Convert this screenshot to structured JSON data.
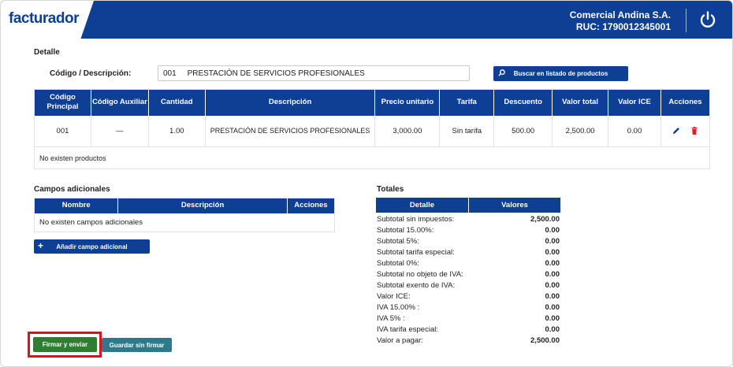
{
  "header": {
    "logo_text": "facturador",
    "company_name": "Comercial Andina S.A.",
    "ruc": "RUC: 1790012345001",
    "colors": {
      "primary": "#0d3f95",
      "accent": "#f0a500"
    },
    "power_icon": "power-icon"
  },
  "detalle": {
    "title": "Detalle",
    "code_label": "Código / Descripción:",
    "code_value": "001     PRESTACIÓN DE SERVICIOS PROFESIONALES",
    "search_button": "Buscar en listado de productos",
    "columns": [
      "Código Principal",
      "Código Auxiliar",
      "Cantidad",
      "Descripción",
      "Precio unitario",
      "Tarifa",
      "Descuento",
      "Valor total",
      "Valor ICE",
      "Acciones"
    ],
    "rows": [
      {
        "codigo_principal": "001",
        "codigo_auxiliar": "—",
        "cantidad": "1.00",
        "descripcion": "PRESTACIÓN DE SERVICIOS PROFESIONALES",
        "precio_unitario": "3,000.00",
        "tarifa": "Sin tarifa",
        "descuento": "500.00",
        "valor_total": "2,500.00",
        "valor_ice": "0.00"
      }
    ],
    "empty_text": "No existen productos"
  },
  "campos": {
    "title": "Campos adicionales",
    "columns": [
      "Nombre",
      "Descripción",
      "Acciones"
    ],
    "empty_text": "No existen campos adicionales",
    "add_button": "Añadir campo adicional"
  },
  "totales": {
    "title": "Totales",
    "columns": [
      "Detalle",
      "Valores"
    ],
    "rows": [
      {
        "label": "Subtotal sin impuestos:",
        "value": "2,500.00"
      },
      {
        "label": "Subtotal 15.00%:",
        "value": "0.00"
      },
      {
        "label": "Subtotal 5%:",
        "value": "0.00"
      },
      {
        "label": "Subtotal tarifa especial:",
        "value": "0.00"
      },
      {
        "label": "Subtotal 0%:",
        "value": "0.00"
      },
      {
        "label": "Subtotal no objeto de IVA:",
        "value": "0.00"
      },
      {
        "label": "Subtotal exento de IVA:",
        "value": "0.00"
      },
      {
        "label": "Valor ICE:",
        "value": "0.00"
      },
      {
        "label": "IVA 15.00% :",
        "value": "0.00"
      },
      {
        "label": "IVA 5% :",
        "value": "0.00"
      },
      {
        "label": "IVA tarifa especial:",
        "value": "0.00"
      },
      {
        "label": "Valor a pagar:",
        "value": "2,500.00"
      }
    ]
  },
  "actions": {
    "sign_send": "Firmar y enviar",
    "save_unsigned": "Guardar sin firmar",
    "sign_color": "#2f7d32",
    "save_color": "#2c7a8c",
    "highlight_color": "#d9141b"
  }
}
